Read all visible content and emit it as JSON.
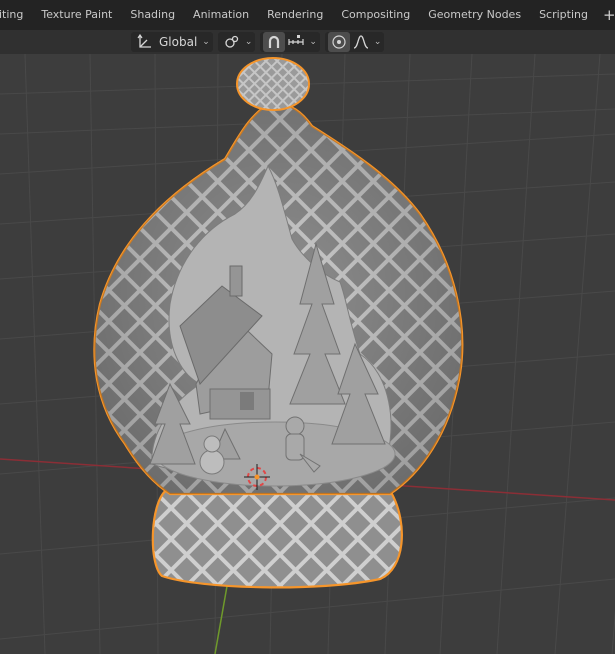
{
  "workspace_tabs": [
    {
      "label": "diting"
    },
    {
      "label": "Texture Paint"
    },
    {
      "label": "Shading"
    },
    {
      "label": "Animation"
    },
    {
      "label": "Rendering"
    },
    {
      "label": "Compositing"
    },
    {
      "label": "Geometry Nodes"
    },
    {
      "label": "Scripting"
    }
  ],
  "add_tab_label": "+",
  "toolbar": {
    "orientation_label": "Global",
    "transform_orientation_icon": "transform-orientation-icon",
    "pivot_icon": "pivot-point-icon",
    "snap_icon": "magnet-snap-icon",
    "snap_increment_icon": "snap-increment-icon",
    "proportional_icon": "proportional-editing-icon",
    "falloff_icon": "falloff-curve-icon"
  },
  "colors": {
    "selection_outline": "#f5952b",
    "x_axis": "#8b2e36",
    "y_axis": "#6f9a2b",
    "grid": "#4a4a4a",
    "viewport_bg": "#3d3d3d"
  }
}
